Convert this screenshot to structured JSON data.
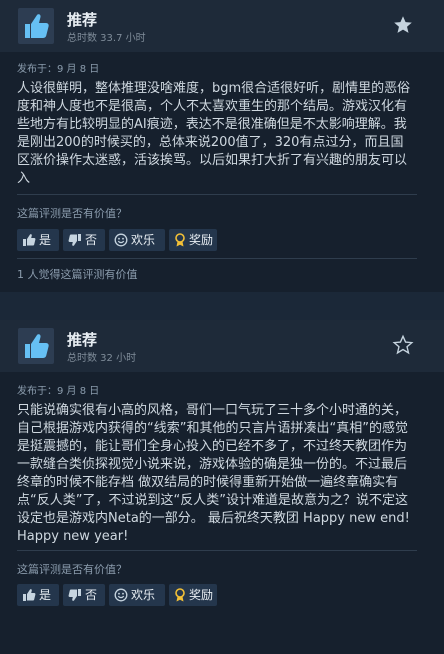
{
  "reviews": [
    {
      "verdict": "推荐",
      "hours": "总时数 33.7 小时",
      "starred": true,
      "posted": "发布于：9 月 8 日",
      "body": "人设很鲜明，整体推理没啥难度，bgm很合适很好听，剧情里的恶俗\n度和神人度也不是很高，个人不太喜欢重生的那个结局。游戏汉化有\n些地方有比较明显的AI痕迹，表达不是很准确但是不太影响理解。我\n是刚出200的时候买的，总体来说200值了，320有点过分，而且国\n区涨价操作太迷惑，活该挨骂。以后如果打大折了有兴趣的朋友可以\n入",
      "helpful_question": "这篇评测是否有价值？",
      "buttons": {
        "yes": "是",
        "no": "否",
        "funny": "欢乐",
        "award": "奖励"
      },
      "helpful_count": "1 人觉得这篇评测有价值"
    },
    {
      "verdict": "推荐",
      "hours": "总时数 32 小时",
      "starred": false,
      "posted": "发布于：9 月 8 日",
      "body": "只能说确实很有小高的风格，哥们一口气玩了三十多个小时通的关，\n自己根据游戏内获得的“线索”和其他的只言片语拼凑出“真相”的感觉\n是挺震撼的，能让哥们全身心投入的已经不多了，不过终天教团作为\n一款缝合类侦探视觉小说来说，游戏体验的确是独一份的。不过最后\n终章的时候不能存档 做双结局的时候得重新开始做一遍终章确实有\n点“反人类”了，不过说到这“反人类”设计难道是故意为之？说不定这\n设定也是游戏内Neta的一部分。 最后祝终天教团 Happy new end!\nHappy new year!",
      "helpful_question": "这篇评测是否有价值？",
      "buttons": {
        "yes": "是",
        "no": "否",
        "funny": "欢乐",
        "award": "奖励"
      }
    }
  ],
  "colors": {
    "accent_star": "#c6d4df",
    "panel": "#16202d",
    "button": "#24364c",
    "award": "#f2c037"
  }
}
